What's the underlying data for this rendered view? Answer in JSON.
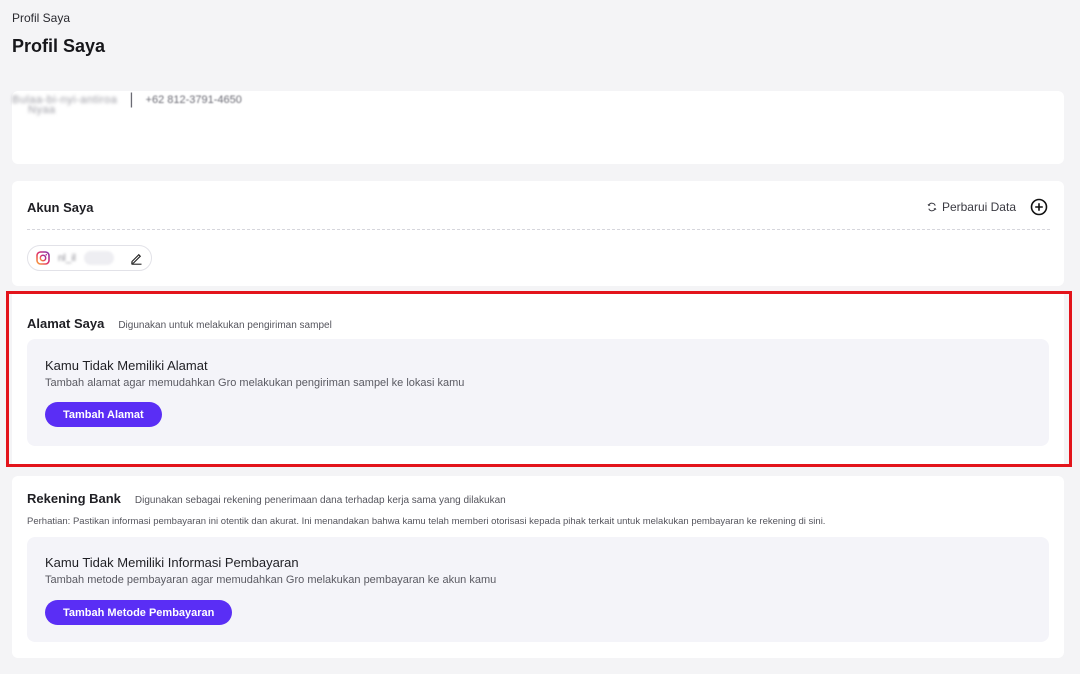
{
  "breadcrumb": "Profil Saya",
  "page_title": "Profil Saya",
  "profile": {
    "name": "Nyaa",
    "username": "Bulaa-bi-nyi-antiroa",
    "separator": "|",
    "phone": "+62 812-3791-4650"
  },
  "akun": {
    "title": "Akun Saya",
    "refresh_label": "Perbarui Data",
    "account_handle": "nl_il"
  },
  "alamat": {
    "title": "Alamat Saya",
    "hint": "Digunakan untuk melakukan pengiriman sampel",
    "empty_title": "Kamu Tidak Memiliki Alamat",
    "empty_desc": "Tambah alamat agar memudahkan Gro melakukan pengiriman sampel ke lokasi kamu",
    "button_label": "Tambah Alamat"
  },
  "rekening": {
    "title": "Rekening Bank",
    "hint": "Digunakan sebagai rekening penerimaan dana terhadap kerja sama yang dilakukan",
    "note": "Perhatian: Pastikan informasi pembayaran ini otentik dan akurat. Ini menandakan bahwa kamu telah memberi otorisasi kepada pihak terkait untuk melakukan pembayaran ke rekening di sini.",
    "empty_title": "Kamu Tidak Memiliki Informasi Pembayaran",
    "empty_desc": "Tambah metode pembayaran agar memudahkan Gro melakukan pembayaran ke akun kamu",
    "button_label": "Tambah Metode Pembayaran"
  },
  "colors": {
    "accent": "#5a2ef5",
    "highlight": "#e3141b",
    "background": "#f4f4f6"
  },
  "icons": [
    "refresh-icon",
    "add-circle-icon",
    "instagram-icon",
    "edit-icon"
  ]
}
